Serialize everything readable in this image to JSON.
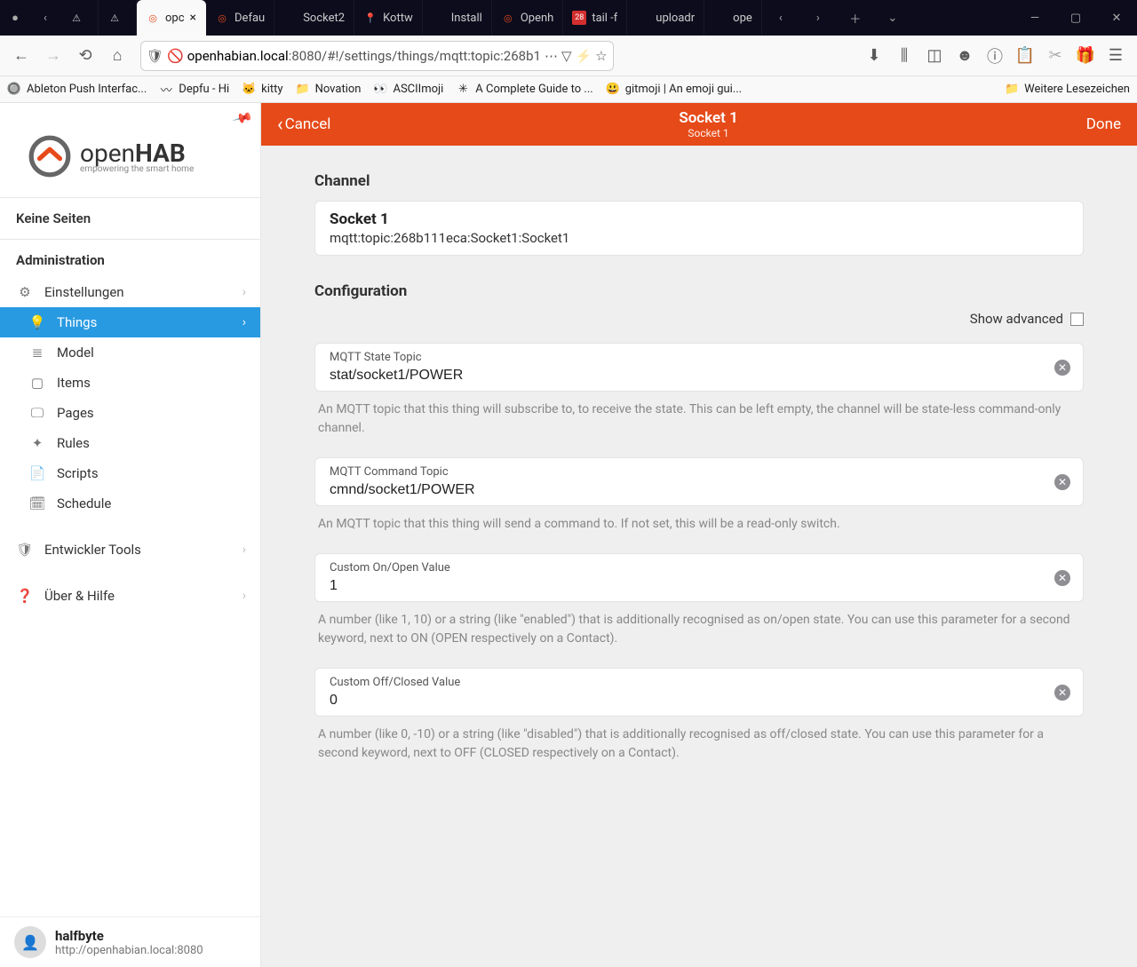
{
  "browser": {
    "tabs": [
      {
        "label": "",
        "glyph": "⚠"
      },
      {
        "label": "",
        "glyph": "⚠"
      },
      {
        "label": "opc",
        "active": true,
        "glyph": "◎"
      },
      {
        "label": "Defau",
        "glyph": "◎"
      },
      {
        "label": "Socket2"
      },
      {
        "label": "Kottw",
        "glyph": "📍"
      },
      {
        "label": "Install"
      },
      {
        "label": "Openh",
        "glyph": "◎"
      },
      {
        "label": "tail -f",
        "glyph": "28"
      },
      {
        "label": "uploadr"
      },
      {
        "label": "ope"
      }
    ],
    "url_host": "openhabian.local",
    "url_port_path": ":8080/#!/settings/things/mqtt:topic:268b1",
    "bookmarks": [
      {
        "label": "Ableton Push Interfac...",
        "glyph": "🔘"
      },
      {
        "label": "Depfu - Hi",
        "glyph": "〰"
      },
      {
        "label": "kitty",
        "glyph": "🐱"
      },
      {
        "label": "Novation",
        "glyph": "📁"
      },
      {
        "label": "ASCIImoji",
        "glyph": "👀"
      },
      {
        "label": "A Complete Guide to ...",
        "glyph": "✳"
      },
      {
        "label": "gitmoji | An emoji gui...",
        "glyph": "😃"
      }
    ],
    "other_bookmarks": "Weitere Lesezeichen"
  },
  "sidebar": {
    "logo_line1": "open",
    "logo_line2": "HAB",
    "logo_sub": "empowering the smart home",
    "no_pages": "Keine Seiten",
    "admin_header": "Administration",
    "items": [
      {
        "label": "Einstellungen",
        "icon": "⚙",
        "chev": true,
        "sub": false
      },
      {
        "label": "Things",
        "icon": "💡",
        "active": true,
        "chev": true,
        "sub": true
      },
      {
        "label": "Model",
        "icon": "≣",
        "sub": true
      },
      {
        "label": "Items",
        "icon": "▢",
        "sub": true
      },
      {
        "label": "Pages",
        "icon": "🖵",
        "sub": true
      },
      {
        "label": "Rules",
        "icon": "✦",
        "sub": true
      },
      {
        "label": "Scripts",
        "icon": "📄",
        "sub": true
      },
      {
        "label": "Schedule",
        "icon": "🗓",
        "sub": true
      },
      {
        "label": "Entwickler Tools",
        "icon": "🛡",
        "chev": true,
        "sub": false,
        "mt": true
      },
      {
        "label": "Über & Hilfe",
        "icon": "❓",
        "chev": true,
        "sub": false,
        "mt": true
      }
    ],
    "footer_user": "halfbyte",
    "footer_url": "http://openhabian.local:8080"
  },
  "topbar": {
    "cancel": "Cancel",
    "title": "Socket 1",
    "subtitle": "Socket 1",
    "done": "Done"
  },
  "content": {
    "channel_header": "Channel",
    "channel_name": "Socket 1",
    "channel_id": "mqtt:topic:268b111eca:Socket1:Socket1",
    "config_header": "Configuration",
    "show_advanced": "Show advanced",
    "fields": [
      {
        "label": "MQTT State Topic",
        "value": "stat/socket1/POWER",
        "help": "An MQTT topic that this thing will subscribe to, to receive the state. This can be left empty, the channel will be state-less command-only channel."
      },
      {
        "label": "MQTT Command Topic",
        "value": "cmnd/socket1/POWER",
        "help": "An MQTT topic that this thing will send a command to. If not set, this will be a read-only switch."
      },
      {
        "label": "Custom On/Open Value",
        "value": "1",
        "help": "A number (like 1, 10) or a string (like \"enabled\") that is additionally recognised as on/open state. You can use this parameter for a second keyword, next to ON (OPEN respectively on a Contact)."
      },
      {
        "label": "Custom Off/Closed Value",
        "value": "0",
        "help": "A number (like 0, -10) or a string (like \"disabled\") that is additionally recognised as off/closed state. You can use this parameter for a second keyword, next to OFF (CLOSED respectively on a Contact)."
      }
    ]
  }
}
